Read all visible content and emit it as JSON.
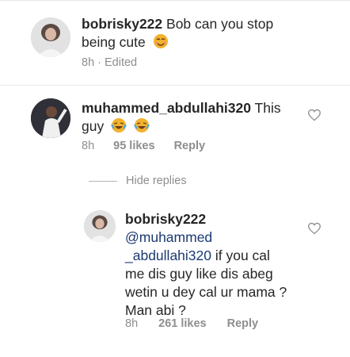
{
  "comments": [
    {
      "username": "bobrisky222",
      "text": "Bob can you stop being cute",
      "text_line2": "being cute",
      "time": "8h",
      "edited": "Edited",
      "separator": "·"
    },
    {
      "username": "muhammed_abdullahi320",
      "text": "This",
      "text_line2": "guy",
      "time": "8h",
      "likes": "95 likes",
      "reply": "Reply"
    }
  ],
  "hide_replies_label": "Hide replies",
  "reply": {
    "username": "bobrisky222",
    "mention_line1": "@muhammed",
    "mention_line2": "_abdullahi320",
    "text_line2_rest": " if you cal",
    "text_line3": "me dis guy like dis abeg",
    "text_line4": "wetin u dey cal ur mama ?",
    "text_line5": "Man abi ?",
    "time": "8h",
    "likes": "261 likes",
    "reply": "Reply"
  },
  "icons": {
    "heart": "heart-outline-icon",
    "emoji_blush": "smiling-face-emoji",
    "emoji_laugh": "face-with-tears-of-joy-emoji"
  },
  "colors": {
    "mention": "#1b3a72",
    "meta": "#8e8e8e",
    "emoji": "#f2b22e"
  }
}
